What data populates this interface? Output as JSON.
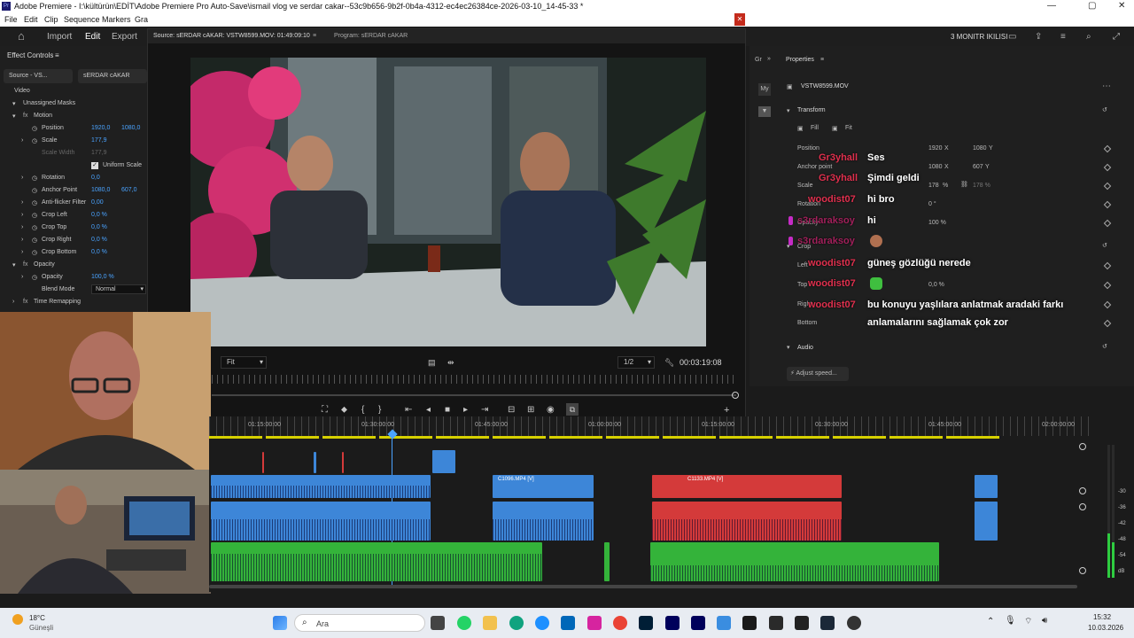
{
  "window": {
    "title": "Adobe Premiere - I:\\kültürün\\EDİT\\Adobe Premiere Pro Auto-Save\\ismail vlog ve serdar cakar--53c9b656-9b2f-0b4a-4312-ec4ec26384ce-2026-03-10_14-45-33 *",
    "app_badge": "Pr"
  },
  "menu": {
    "items": [
      "File",
      "Edit",
      "Clip",
      "Sequence",
      "Markers",
      "Gra"
    ]
  },
  "header": {
    "import": "Import",
    "edit": "Edit",
    "export": "Export",
    "workspace": "3 MONITR IKILISI"
  },
  "effect_controls": {
    "title": "Effect Controls",
    "tab_source": "Source - VS...",
    "tab_seq": "sERDAR cAKAR",
    "video": "Video",
    "masks": "Unassigned Masks",
    "motion": "Motion",
    "position_label": "Position",
    "position_x": "1920,0",
    "position_y": "1080,0",
    "scale_label": "Scale",
    "scale_val": "177,9",
    "scalew_label": "Scale Width",
    "scalew_val": "177,9",
    "uniform": "Uniform Scale",
    "rotation_label": "Rotation",
    "rotation_val": "0,0",
    "anchor_label": "Anchor Point",
    "anchor_x": "1080,0",
    "anchor_y": "607,0",
    "flicker_label": "Anti-flicker Filter",
    "flicker_val": "0,00",
    "cropl_label": "Crop Left",
    "cropl_val": "0,0 %",
    "cropt_label": "Crop Top",
    "cropt_val": "0,0 %",
    "cropr_label": "Crop Right",
    "cropr_val": "0,0 %",
    "cropb_label": "Crop Bottom",
    "cropb_val": "0,0 %",
    "opacity_section": "Opacity",
    "opacity_label": "Opacity",
    "opacity_val": "100,0 %",
    "blend_label": "Blend Mode",
    "blend_val": "Normal",
    "time_remap": "Time Remapping"
  },
  "source_monitor": {
    "source_tab": "Source: sERDAR cAKAR: VSTW8599.MOV: 01:49:09:10",
    "program_tab": "Program: sERDAR cAKAR",
    "fit": "Fit",
    "fraction": "1/2",
    "timecode": "00:03:19:08"
  },
  "properties": {
    "title": "Properties",
    "clip": "VSTW8599.MOV",
    "transform": "Transform",
    "fill": "Fill",
    "fit": "Fit",
    "position": "Position",
    "pos_x": "1920",
    "pos_x_unit": "X",
    "pos_y": "1080",
    "pos_y_unit": "Y",
    "anchor": "Anchor point",
    "anc_x": "1080",
    "anc_x_unit": "X",
    "anc_y": "607",
    "anc_y_unit": "Y",
    "scale": "Scale",
    "scale_val": "178",
    "scale_pct": "%",
    "scale2": "178 %",
    "rotation": "Rotation",
    "rotation_val": "0 °",
    "opacity": "Opacity",
    "opacity_val": "100 %",
    "crop": "Crop",
    "left": "Left",
    "top": "Top",
    "top_val": "0,0 %",
    "right": "Right",
    "bottom": "Bottom",
    "audio": "Audio",
    "adjust": "Adjust speed..."
  },
  "chat": [
    {
      "name": "Gr3yhall",
      "msg": "Ses"
    },
    {
      "name": "Gr3yhall",
      "msg": "Şimdi geldi"
    },
    {
      "name": "woodist07",
      "msg": "hi bro"
    },
    {
      "name": "s3rdaraksoy",
      "msg": "hi"
    },
    {
      "name": "s3rdaraksoy",
      "msg": ""
    },
    {
      "name": "woodist07",
      "msg": "güneş gözlüğü nerede"
    },
    {
      "name": "woodist07",
      "msg": ""
    },
    {
      "name": "woodist07",
      "msg": "bu konuyu yaşlılara anlatmak aradaki farkı"
    },
    {
      "name": "",
      "msg": "anlamalarını sağlamak çok zor"
    }
  ],
  "timeline": {
    "ruler": [
      "01:15:00:00",
      "01:30:00:00",
      "01:45:00:00",
      "02:00:00:00"
    ],
    "ruler_extra": [
      "01:15:00:00",
      "01:30:00:00",
      "01:45:00:00",
      "01:00:00:00",
      "01:15:00:00"
    ],
    "clip1": "C1096.MP4 [V]",
    "clip2": "C1133.MP4 [V]"
  },
  "meters": {
    "labels": [
      "-30",
      "-36",
      "-42",
      "-48",
      "-54",
      "dB"
    ]
  },
  "taskbar": {
    "temp": "18°C",
    "weather": "Güneşli",
    "search": "Ara",
    "time": "15:32",
    "date": "10.03.2026"
  }
}
